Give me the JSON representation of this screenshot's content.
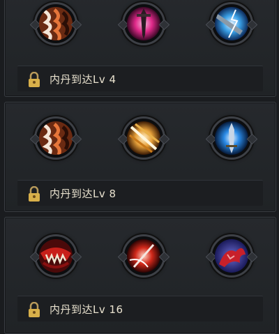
{
  "tiers": [
    {
      "skills": [
        {
          "icon": "tiger-stripe-skill-icon",
          "palette": [
            "#6a2a12",
            "#e6763a",
            "#f4e6d8"
          ]
        },
        {
          "icon": "pink-sword-skill-icon",
          "palette": [
            "#5a0d3a",
            "#e0298a",
            "#f4b6d8"
          ]
        },
        {
          "icon": "lightning-blade-skill-icon",
          "palette": [
            "#0d2a5a",
            "#3aa0e6",
            "#e8f4ff"
          ]
        }
      ],
      "lock_text": "内丹到达Lv 4"
    },
    {
      "skills": [
        {
          "icon": "tiger-stripe-skill-icon",
          "palette": [
            "#6a2a12",
            "#e6763a",
            "#f4e6d8"
          ]
        },
        {
          "icon": "golden-slash-skill-icon",
          "palette": [
            "#5a2a08",
            "#e6a03a",
            "#fff0c8"
          ]
        },
        {
          "icon": "blue-blade-skill-icon",
          "palette": [
            "#0a2a5a",
            "#2a8ae6",
            "#e8f4ff"
          ]
        }
      ],
      "lock_text": "内丹到达Lv 8"
    },
    {
      "skills": [
        {
          "icon": "beast-jaw-skill-icon",
          "palette": [
            "#4a0a0a",
            "#c8201a",
            "#f0e6d0"
          ]
        },
        {
          "icon": "crimson-slash-skill-icon",
          "palette": [
            "#4a0808",
            "#d0281a",
            "#ffd0c0"
          ]
        },
        {
          "icon": "red-dragon-skill-icon",
          "palette": [
            "#1a1a5a",
            "#c8202a",
            "#f0a0a0"
          ]
        }
      ],
      "lock_text": "内丹到达Lv 16"
    }
  ]
}
